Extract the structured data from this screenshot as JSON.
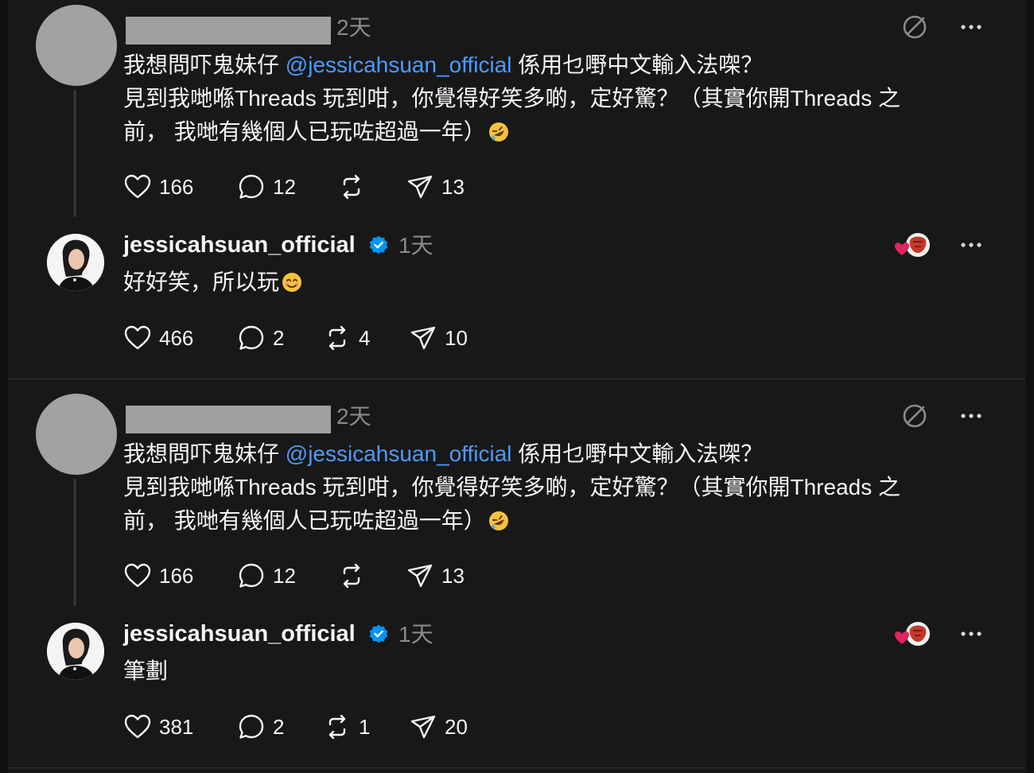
{
  "threads": [
    {
      "parent": {
        "time": "2天",
        "text_before": "我想問吓鬼妹仔 ",
        "mention": "@jessicahsuan_official",
        "text_after": " 係用乜嘢中文輸入法㗎？\n見到我哋喺Threads 玩到咁，你覺得好笑多啲，定好驚？（其實你開Threads 之\n前， 我哋有幾個人已玩咗超過一年）",
        "emoji": "rolling-on-floor-laughing",
        "likes": "166",
        "replies": "12",
        "reposts": "",
        "shares": "13"
      },
      "reply": {
        "username": "jessicahsuan_official",
        "time": "1天",
        "text": "好好笑，所以玩",
        "emoji": "smiling-face",
        "likes": "466",
        "replies": "2",
        "reposts": "4",
        "shares": "10"
      }
    },
    {
      "parent": {
        "time": "2天",
        "text_before": "我想問吓鬼妹仔 ",
        "mention": "@jessicahsuan_official",
        "text_after": " 係用乜嘢中文輸入法㗎？\n見到我哋喺Threads 玩到咁，你覺得好笑多啲，定好驚？（其實你開Threads 之\n前， 我哋有幾個人已玩咗超過一年）",
        "emoji": "rolling-on-floor-laughing",
        "likes": "166",
        "replies": "12",
        "reposts": "",
        "shares": "13"
      },
      "reply": {
        "username": "jessicahsuan_official",
        "time": "1天",
        "text": "筆劃",
        "emoji": "",
        "likes": "381",
        "replies": "2",
        "reposts": "1",
        "shares": "20"
      }
    }
  ],
  "colors": {
    "background": "#181818",
    "mention": "#4b9bff",
    "muted": "#8a8a8a",
    "verified": "#0095f6",
    "heart_red": "#e0245e"
  }
}
